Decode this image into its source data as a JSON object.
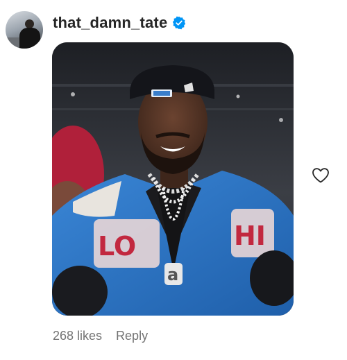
{
  "comment": {
    "username": "that_damn_tate",
    "verified": true,
    "likes_text": "268 likes",
    "reply_label": "Reply"
  },
  "icons": {
    "verified": "verified-badge-icon",
    "like": "heart-outline-icon"
  },
  "colors": {
    "username": "#262626",
    "verified": "#0095f6",
    "meta_text": "#737373"
  }
}
